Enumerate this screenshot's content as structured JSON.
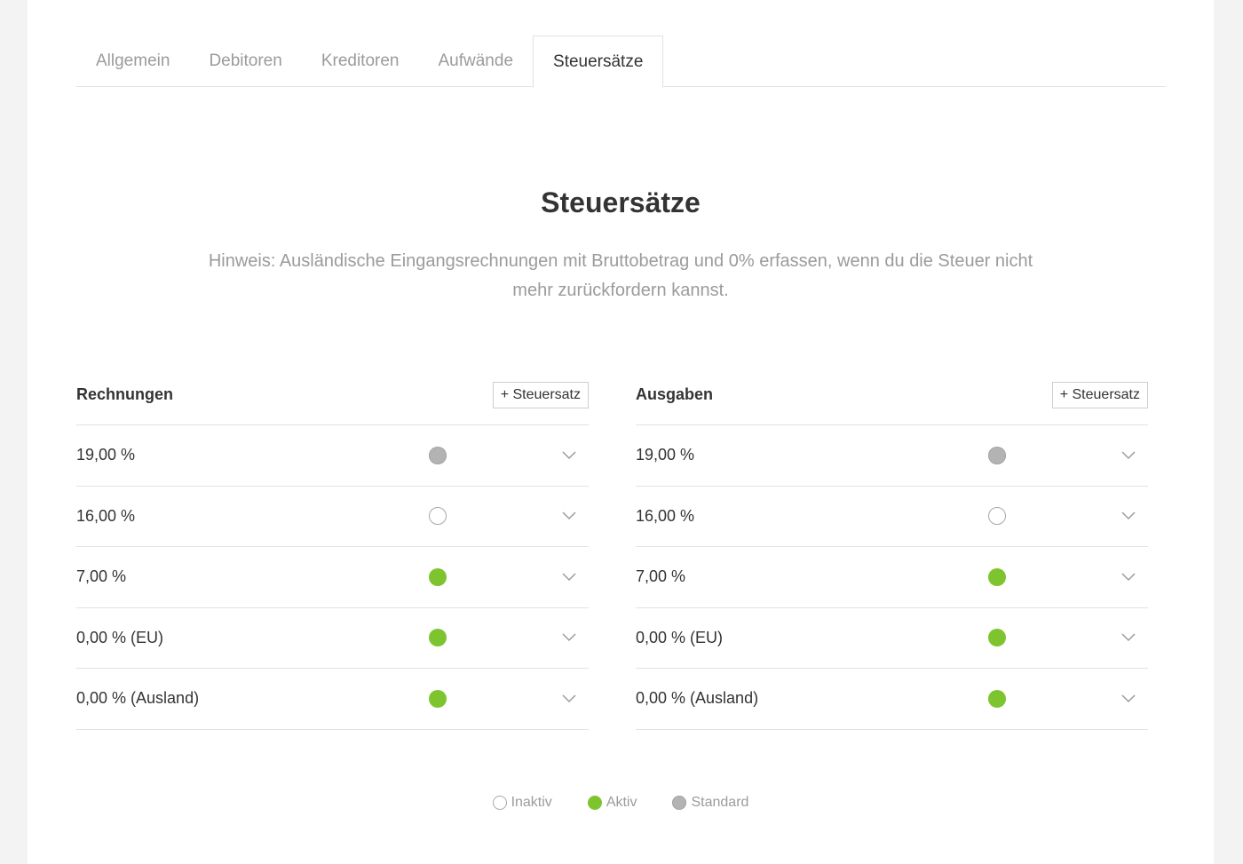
{
  "tabs": [
    {
      "label": "Allgemein",
      "active": false
    },
    {
      "label": "Debitoren",
      "active": false
    },
    {
      "label": "Kreditoren",
      "active": false
    },
    {
      "label": "Aufwände",
      "active": false
    },
    {
      "label": "Steuersätze",
      "active": true
    }
  ],
  "page": {
    "title": "Steuersätze",
    "hint": "Hinweis: Ausländische Eingangsrechnungen mit Bruttobetrag und 0% erfassen, wenn du die Steuer nicht mehr zurückfordern kannst."
  },
  "invoices": {
    "title": "Rechnungen",
    "add_label": "+ Steuersatz",
    "rows": [
      {
        "rate": "19,00 %",
        "status": "standard"
      },
      {
        "rate": "16,00 %",
        "status": "inactive"
      },
      {
        "rate": "7,00 %",
        "status": "active"
      },
      {
        "rate": "0,00 % (EU)",
        "status": "active"
      },
      {
        "rate": "0,00 % (Ausland)",
        "status": "active"
      }
    ]
  },
  "expenses": {
    "title": "Ausgaben",
    "add_label": "+ Steuersatz",
    "rows": [
      {
        "rate": "19,00 %",
        "status": "standard"
      },
      {
        "rate": "16,00 %",
        "status": "inactive"
      },
      {
        "rate": "7,00 %",
        "status": "active"
      },
      {
        "rate": "0,00 % (EU)",
        "status": "active"
      },
      {
        "rate": "0,00 % (Ausland)",
        "status": "active"
      }
    ]
  },
  "legend": {
    "inactive": "Inaktiv",
    "active": "Aktiv",
    "standard": "Standard"
  },
  "colors": {
    "active": "#7dc42e",
    "standard": "#b3b3b3",
    "inactive_border": "#a8a8a8"
  }
}
